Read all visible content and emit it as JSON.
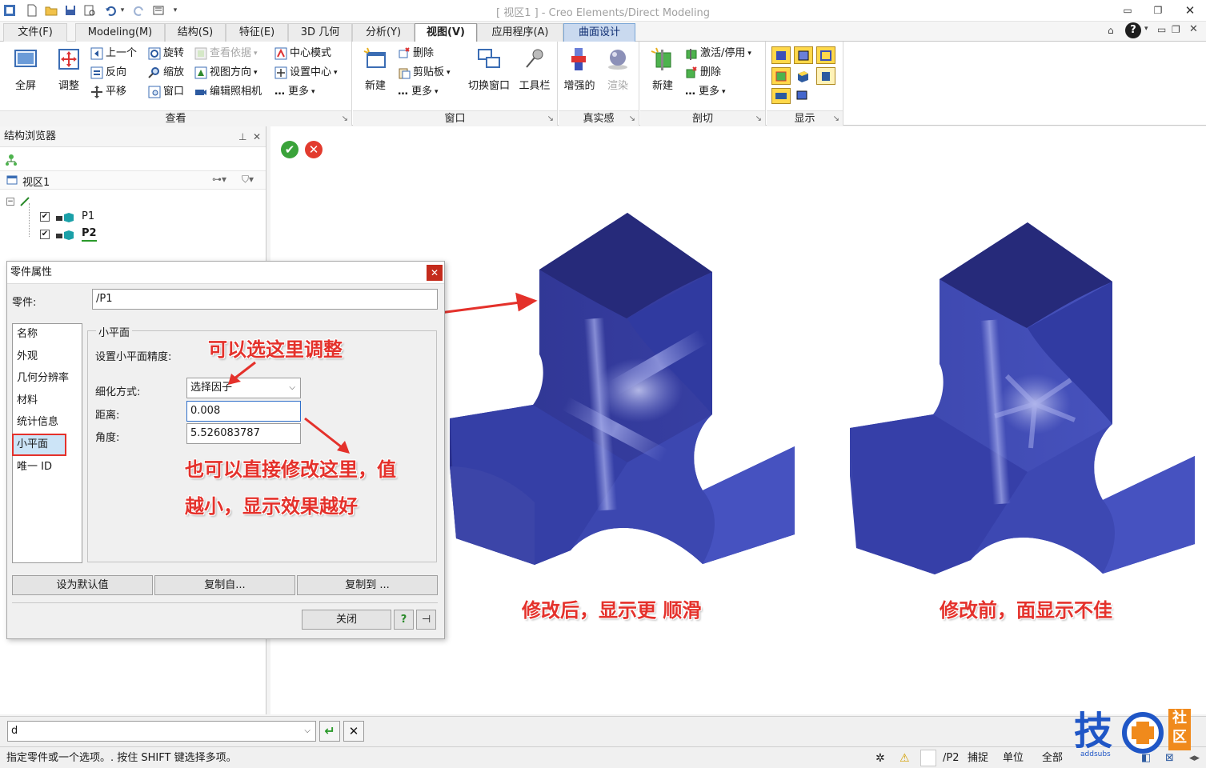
{
  "window": {
    "title": "[ 视区1 ] - Creo Elements/Direct Modeling",
    "accent": "#1f3a8a"
  },
  "tabs": [
    {
      "label": "文件(F)"
    },
    {
      "label": "Modeling(M)"
    },
    {
      "label": "结构(S)"
    },
    {
      "label": "特征(E)"
    },
    {
      "label": "3D 几何"
    },
    {
      "label": "分析(Y)"
    },
    {
      "label": "视图(V)"
    },
    {
      "label": "应用程序(A)"
    },
    {
      "label": "曲面设计"
    }
  ],
  "ribbon": {
    "view": {
      "label": "查看",
      "fullscreen": "全屏",
      "adjust": "调整",
      "prev": "上一个",
      "reverse": "反向",
      "pan": "平移",
      "rotate": "旋转",
      "zoom": "缩放",
      "window": "窗口",
      "view_basis": "查看依据",
      "view_direction": "视图方向",
      "edit_camera": "编辑照相机",
      "center_mode": "中心模式",
      "set_center": "设置中心",
      "more": "更多"
    },
    "window": {
      "label": "窗口",
      "new": "新建",
      "delete": "删除",
      "clipboard": "剪贴板",
      "more": "更多",
      "switch_window": "切换窗口",
      "toolbar": "工具栏"
    },
    "realism": {
      "label": "真实感",
      "enhanced": "增强的",
      "render": "渲染"
    },
    "section": {
      "label": "剖切",
      "new": "新建",
      "activate": "激活/停用",
      "delete": "删除",
      "more": "更多"
    },
    "display": {
      "label": "显示"
    }
  },
  "browser": {
    "title": "结构浏览器",
    "view": "视区1",
    "items": [
      {
        "name": "P1"
      },
      {
        "name": "P2"
      }
    ]
  },
  "dialog": {
    "title": "零件属性",
    "part_label": "零件:",
    "part_value": "/P1",
    "categories": [
      "名称",
      "外观",
      "几何分辨率",
      "材料",
      "统计信息",
      "小平面",
      "唯一 ID"
    ],
    "group_title": "小平面",
    "precision_label": "设置小平面精度:",
    "refine_label": "细化方式:",
    "refine_value": "选择因子",
    "distance_label": "距离:",
    "distance_value": "0.008",
    "angle_label": "角度:",
    "angle_value": "5.526083787",
    "btn_default": "设为默认值",
    "btn_copy_from": "复制自...",
    "btn_copy_to": "复制到 ...",
    "btn_close": "关闭"
  },
  "annotations": {
    "choose_here": "可以选这里调整",
    "edit_here_1": "也可以直接修改这里，值",
    "edit_here_2": "越小，显示效果越好",
    "after": "修改后，显示更 顺滑",
    "before": "修改前，面显示不佳",
    "color": "#e4312b"
  },
  "command": {
    "value": "d"
  },
  "status": {
    "message": "指定零件或一个选项。. 按住 SHIFT 键选择多项。",
    "part": "/P2",
    "snap": "捕捉",
    "unit": "单位",
    "all": "全部"
  },
  "logo": {
    "char": "技",
    "side": "社区",
    "url": "addsubs"
  }
}
